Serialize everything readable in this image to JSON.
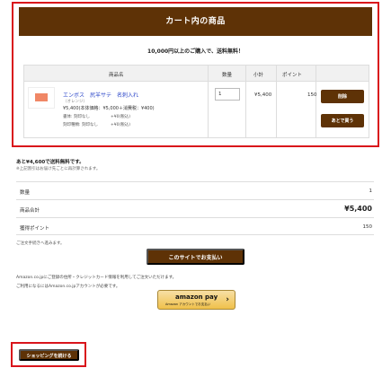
{
  "cart": {
    "title": "カート内の商品",
    "free_shipping_note": "10,000円以上のご購入で、送料無料！",
    "columns": [
      "商品名",
      "数量",
      "小計",
      "ポイント"
    ],
    "item": {
      "name": "エンボス　尻羊サテ　名刺入れ",
      "variant": "（オレンジ）",
      "price": "¥5,400(本体価格：¥5,000＋消費税：¥400)",
      "options": [
        {
          "label": "書体: 刻印なし",
          "price": "+¥0(税込)"
        },
        {
          "label": "刻印種類: 刻印なし",
          "price": "+¥0(税込)"
        }
      ],
      "quantity": "1",
      "subtotal": "¥5,400",
      "points": "150",
      "delete_label": "削除",
      "later_label": "あとで買う"
    }
  },
  "remaining": {
    "text": "あと¥4,600で送料無料です。",
    "note": "※上記割引はお届け先ごとに再計算されます。"
  },
  "summary": {
    "rows": [
      {
        "label": "数量",
        "value": "1"
      },
      {
        "label": "商品合計",
        "value": "¥5,400"
      },
      {
        "label": "獲得ポイント",
        "value": "150"
      }
    ]
  },
  "checkout": {
    "proceed_text": "ご注文手続きへ進みます。",
    "pay_button": "このサイトでお支払い",
    "amazon_text1": "Amazon.co.jpにご登録の住所・クレジットカード情報を利用してご注文いただけます。",
    "amazon_text2": "ご利用になるにはAmazon.co.jpアカウントが必要です。",
    "amazon_logo": "amazon pay",
    "amazon_sub": "Amazon アカウントでお支払い"
  },
  "continue_shopping": "ショッピングを続ける",
  "colors": {
    "brand": "#5e3206",
    "highlight": "#d9141b",
    "link": "#2c47c9"
  }
}
